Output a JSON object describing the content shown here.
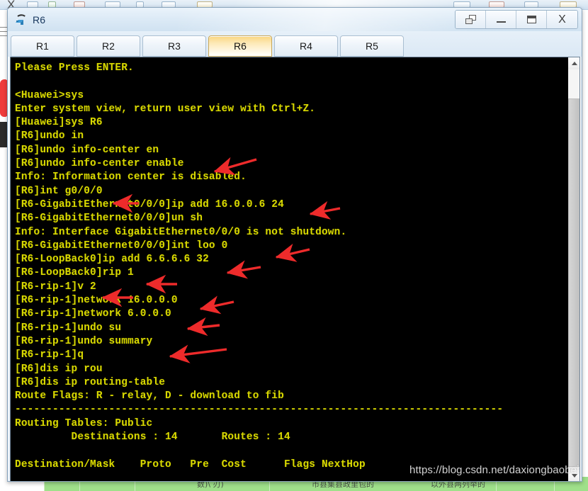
{
  "window": {
    "title": "R6",
    "icon": "router-icon",
    "controls": [
      {
        "name": "restore-down-button",
        "label": "",
        "icon": "restore-icon"
      },
      {
        "name": "minimize-button",
        "label": "",
        "icon": "minimize-icon"
      },
      {
        "name": "maximize-button",
        "label": "",
        "icon": "maximize-icon"
      },
      {
        "name": "close-button",
        "label": "X",
        "icon": "close-icon"
      }
    ]
  },
  "tabs": [
    {
      "label": "R1",
      "active": false
    },
    {
      "label": "R2",
      "active": false
    },
    {
      "label": "R3",
      "active": false
    },
    {
      "label": "R6",
      "active": true
    },
    {
      "label": "R4",
      "active": false
    },
    {
      "label": "R5",
      "active": false
    }
  ],
  "terminal": {
    "foreground_color": "#d8d800",
    "background_color": "#000000",
    "lines": [
      "Please Press ENTER.",
      "",
      "<Huawei>sys",
      "Enter system view, return user view with Ctrl+Z.",
      "[Huawei]sys R6",
      "[R6]undo in",
      "[R6]undo info-center en",
      "[R6]undo info-center enable",
      "Info: Information center is disabled.",
      "[R6]int g0/0/0",
      "[R6-GigabitEthernet0/0/0]ip add 16.0.0.6 24",
      "[R6-GigabitEthernet0/0/0]un sh",
      "Info: Interface GigabitEthernet0/0/0 is not shutdown.",
      "[R6-GigabitEthernet0/0/0]int loo 0",
      "[R6-LoopBack0]ip add 6.6.6.6 32",
      "[R6-LoopBack0]rip 1",
      "[R6-rip-1]v 2",
      "[R6-rip-1]network 16.0.0.0",
      "[R6-rip-1]network 6.0.0.0",
      "[R6-rip-1]undo su",
      "[R6-rip-1]undo summary",
      "[R6-rip-1]q",
      "[R6]dis ip rou",
      "[R6]dis ip routing-table",
      "Route Flags: R - relay, D - download to fib",
      "------------------------------------------------------------------------------",
      "Routing Tables: Public",
      "         Destinations : 14       Routes : 14",
      "",
      "Destination/Mask    Proto   Pre  Cost      Flags NextHop"
    ]
  },
  "scrollbar": {
    "up_arrow": "chevron-up-icon",
    "down_arrow": "chevron-down-icon"
  },
  "annotations": {
    "arrow_color": "#ee2b2b",
    "arrows": [
      {
        "target_line": "[R6]undo info-center enable"
      },
      {
        "target_line": "[R6]int g0/0/0"
      },
      {
        "target_line": "[R6-GigabitEthernet0/0/0]ip add 16.0.0.6 24"
      },
      {
        "target_line": "[R6-GigabitEthernet0/0/0]int loo 0"
      },
      {
        "target_line": "[R6-LoopBack0]ip add 6.6.6.6 32"
      },
      {
        "target_line": "[R6-LoopBack0]rip 1"
      },
      {
        "target_line": "[R6-rip-1]v 2"
      },
      {
        "target_line": "[R6-rip-1]network 16.0.0.0"
      },
      {
        "target_line": "[R6-rip-1]network 6.0.0.0"
      },
      {
        "target_line": "[R6-rip-1]undo summary"
      }
    ]
  },
  "watermark": {
    "text": "https://blog.csdn.net/daxiongbaobei"
  },
  "background": {
    "bottom_band_text_1": "数)\\ 刃)",
    "bottom_band_text_2": "市县集县政里包的",
    "bottom_band_text_3": "以外县两列举的"
  }
}
